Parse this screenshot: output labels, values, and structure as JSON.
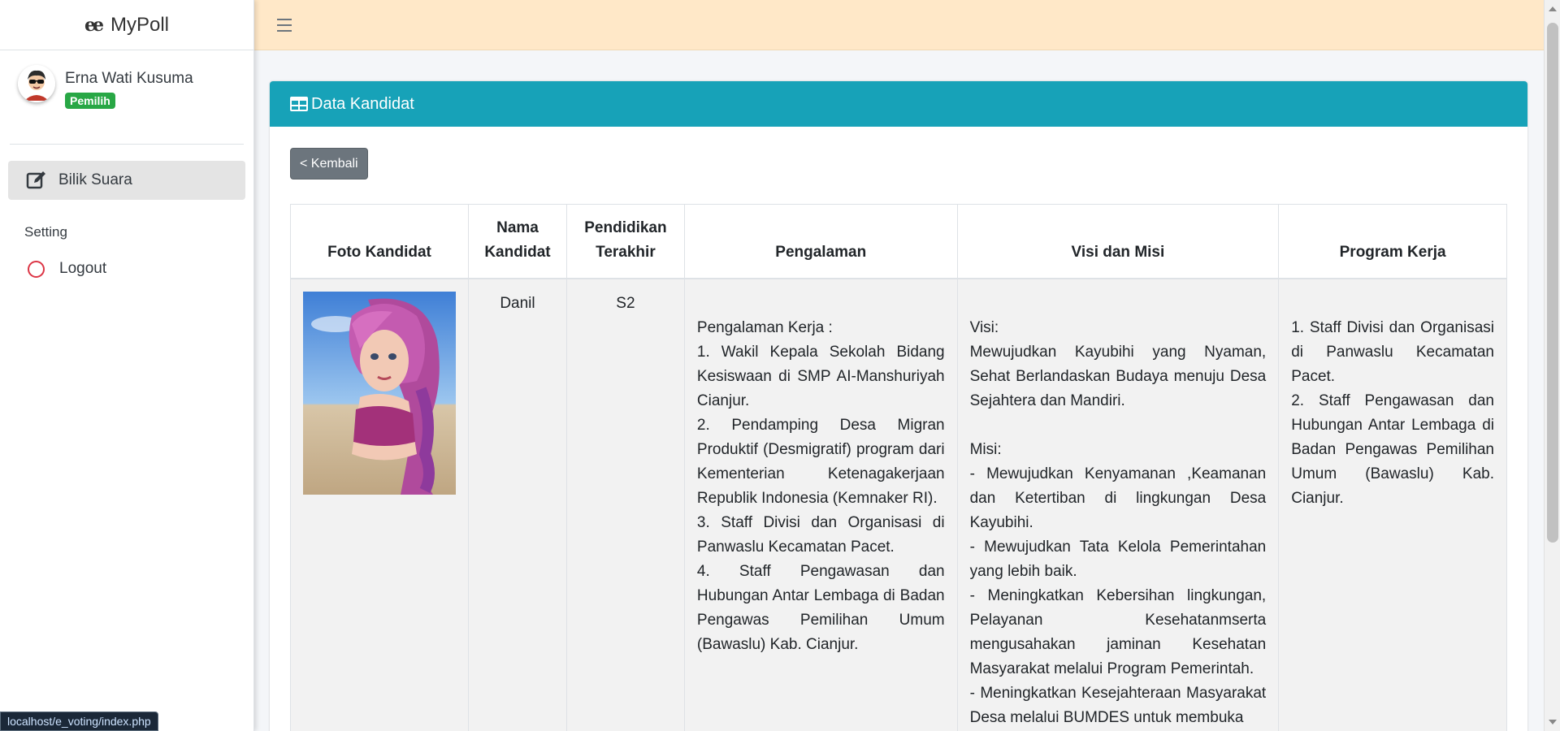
{
  "app": {
    "brand_logo": "ee",
    "brand_name": "MyPoll"
  },
  "user": {
    "name": "Erna Wati Kusuma",
    "role": "Pemilih"
  },
  "sidebar": {
    "items": [
      {
        "label": "Bilik Suara",
        "icon": "edit-icon",
        "active": true
      }
    ],
    "header": "Setting",
    "logout_label": "Logout"
  },
  "card": {
    "title": "Data Kandidat",
    "back_label": "< Kembali"
  },
  "table": {
    "headers": [
      "Foto Kandidat",
      "Nama Kandidat",
      "Pendidikan Terakhir",
      "Pengalaman",
      "Visi dan Misi",
      "Program Kerja"
    ],
    "rows": [
      {
        "nama": "Danil",
        "pendidikan": "S2",
        "pengalaman": "Pengalaman Kerja :\n1. Wakil Kepala Sekolah Bidang Kesiswaan di SMP AI-Manshuriyah Cianjur.\n2. Pendamping Desa Migran Produktif (Desmigratif) program dari Kementerian Ketenagakerjaan Republik Indonesia (Kemnaker RI).\n3. Staff Divisi dan Organisasi di Panwaslu Kecamatan Pacet.\n4. Staff Pengawasan dan Hubungan Antar Lembaga di Badan Pengawas Pemilihan Umum (Bawaslu) Kab. Cianjur.",
        "visi_misi": "Visi:\nMewujudkan Kayubihi yang Nyaman, Sehat Berlandaskan Budaya menuju Desa Sejahtera dan Mandiri.\n\nMisi:\n- Mewujudkan Kenyamanan ,Keamanan dan Ketertiban di lingkungan Desa Kayubihi.\n- Mewujudkan Tata Kelola Pemerintahan yang lebih baik.\n- Meningkatkan Kebersihan lingkungan, Pelayanan Kesehatanmserta mengusahakan jaminan Kesehatan Masyarakat melalui Program Pemerintah.\n- Meningkatkan Kesejahteraan Masyarakat Desa melalui BUMDES untuk membuka",
        "program_kerja": "1. Staff Divisi dan Organisasi di Panwaslu Kecamatan Pacet.\n2. Staff Pengawasan dan Hubungan Antar Lembaga di Badan Pengawas Pemilihan Umum (Bawaslu) Kab. Cianjur."
      }
    ]
  },
  "status_bar": {
    "url": "localhost/e_voting/index.php"
  },
  "colors": {
    "header": "#17a2b8",
    "topbar": "#ffe8c8",
    "badge": "#28a745",
    "logout_icon": "#dc3545"
  }
}
